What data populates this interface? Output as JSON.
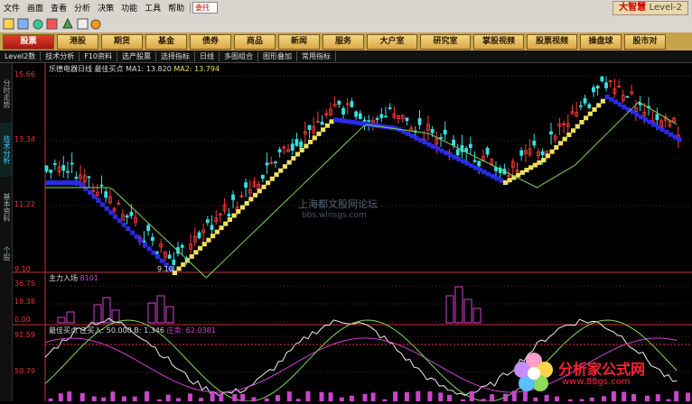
{
  "menu": [
    "文件",
    "画面",
    "查看",
    "分析",
    "决策",
    "功能",
    "工具",
    "帮助",
    "委托"
  ],
  "search_text": "委托",
  "brand": {
    "name": "大智慧",
    "edition": "Level-2"
  },
  "nav": [
    {
      "label": "股票",
      "active": true
    },
    {
      "label": "港股",
      "active": false
    },
    {
      "label": "期货",
      "active": false
    },
    {
      "label": "基金",
      "active": false
    },
    {
      "label": "债券",
      "active": false
    },
    {
      "label": "商品",
      "active": false
    },
    {
      "label": "新闻",
      "active": false
    },
    {
      "label": "服务",
      "active": false
    },
    {
      "label": "大户室",
      "active": false
    },
    {
      "label": "研究室",
      "active": false
    },
    {
      "label": "掌股视频",
      "active": false
    },
    {
      "label": "股票视频",
      "active": false
    },
    {
      "label": "操盘球",
      "active": false
    },
    {
      "label": "股市对",
      "active": false
    }
  ],
  "tabs": [
    "Level2数",
    "技术分析",
    "F10资料",
    "选产股票",
    "选择指标",
    "日线",
    "多图组合",
    "图形叠加",
    "常用指标"
  ],
  "sidebar": [
    {
      "label": "分时走势",
      "active": false
    },
    {
      "label": "技术分析",
      "active": true
    },
    {
      "label": "基本资料",
      "active": false
    },
    {
      "label": "个股",
      "active": false
    }
  ],
  "main_panel": {
    "title": "乐德电器日线",
    "indicator": "最佳买点",
    "ma1_label": "MA1:",
    "ma1_value": "13.820",
    "ma2_label": "MA2:",
    "ma2_value": "13.794",
    "y_labels": [
      "15.66",
      "13.34",
      "11.22",
      "9.10"
    ],
    "low_marker": "9.10"
  },
  "panel2": {
    "title": "主力入场",
    "value": "8101",
    "y_labels": [
      "36.75",
      "18.38",
      "0.00"
    ]
  },
  "panel3": {
    "title": "最佳买点",
    "label_a": "庄买入:",
    "value_a": "50.000",
    "label_b": "B:",
    "value_b": "1.346",
    "label_c": "庄卖:",
    "value_c": "62.0381",
    "y_labels": [
      "91.59",
      "50.79"
    ]
  },
  "watermark": {
    "line1": "上海都文股网论坛",
    "line2": "bbs.wlnsgs.com"
  },
  "site_logo": {
    "name": "分析家公式网",
    "url": "www.88gs.com"
  },
  "colors": {
    "up": "#ff3b3b",
    "down": "#38e0e0",
    "ma_blue": "#2a2ae6",
    "ma_yellow": "#f0e060",
    "line_green": "#7ed957",
    "magenta": "#cc44cc"
  }
}
